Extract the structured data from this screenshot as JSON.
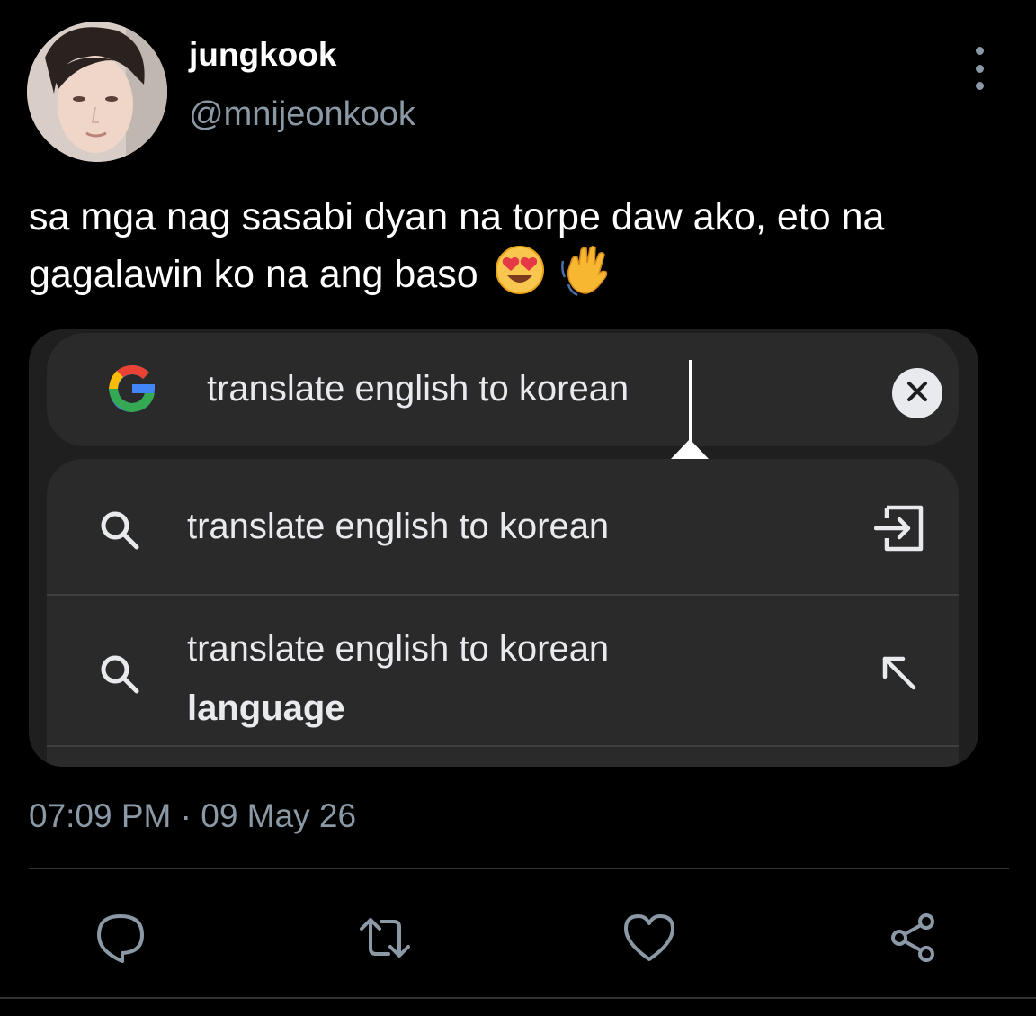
{
  "tweet": {
    "display_name": "jungkook",
    "handle": "@mnijeonkook",
    "text": "sa mga nag sasabi dyan na torpe daw ako, eto na gagalawin ko na ang baso",
    "emojis": [
      "heart-eyes-emoji",
      "waving-hand-emoji"
    ],
    "timestamp": "07:09 PM · 09 May 26"
  },
  "media": {
    "search_query": "translate english to korean",
    "suggestions": [
      {
        "text": "translate english to korean",
        "bold_suffix": "",
        "action_icon": "insert-arrow-icon"
      },
      {
        "text": "translate english to korean",
        "bold_suffix": "language",
        "action_icon": "arrow-up-left-icon"
      }
    ]
  },
  "colors": {
    "background": "#000000",
    "secondary_text": "#8b98a5",
    "media_bg": "#1f1f20",
    "search_bg": "#2a2a2b"
  },
  "actions": [
    "reply-icon",
    "retweet-icon",
    "like-icon",
    "share-icon"
  ]
}
